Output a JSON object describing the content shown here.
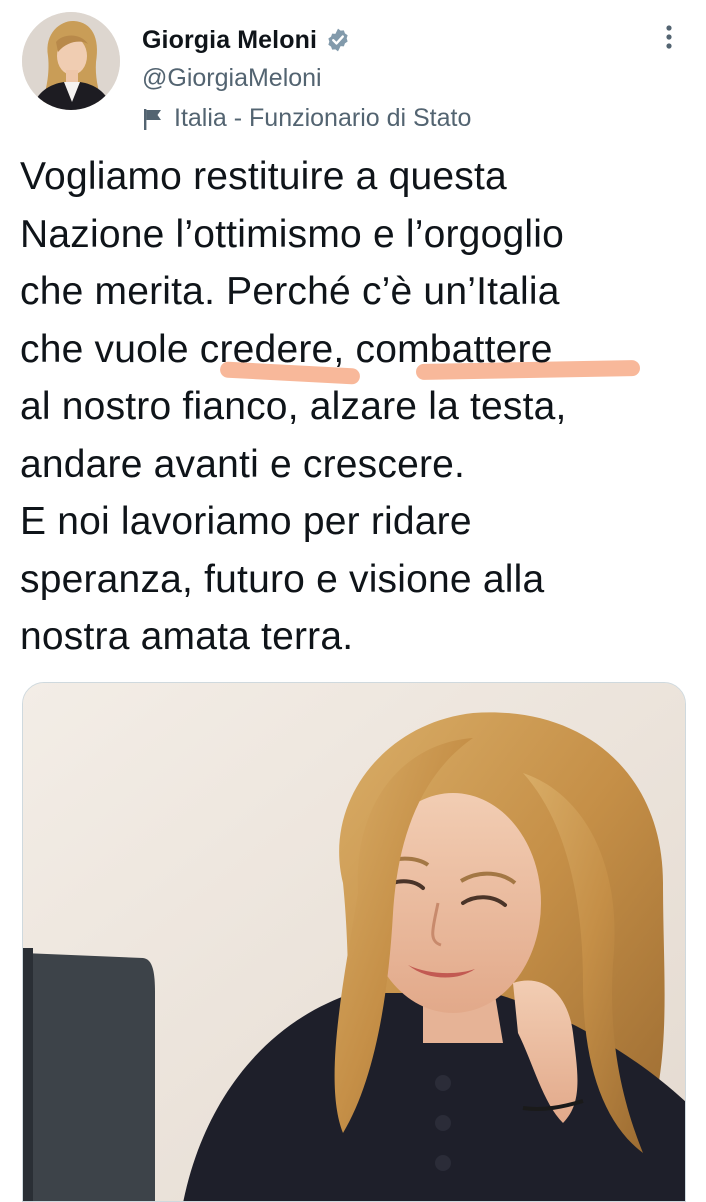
{
  "author": {
    "display_name": "Giorgia Meloni",
    "handle": "@GiorgiaMeloni",
    "label": "Italia - Funzionario di Stato",
    "verified": true
  },
  "tweet": {
    "text": "Vogliamo restituire a questa\nNazione l’ottimismo e l’orgoglio\nche merita. Perché c’è un’Italia\nche vuole credere, combattere\nal nostro fianco, alzare la testa,\nandare avanti e crescere.\nE noi lavoriamo per ridare\nsperanza, futuro e visione alla\nnostra amata terra.",
    "highlighted_words": [
      "credere",
      "combattere"
    ],
    "highlight_color": "#f6a884"
  },
  "icons": {
    "verified": "verified-badge-icon",
    "label_flag": "flag-icon",
    "more": "more-options-icon"
  },
  "colors": {
    "primary_text": "#0f1419",
    "secondary_text": "#536471",
    "verified_badge": "#829aab"
  }
}
